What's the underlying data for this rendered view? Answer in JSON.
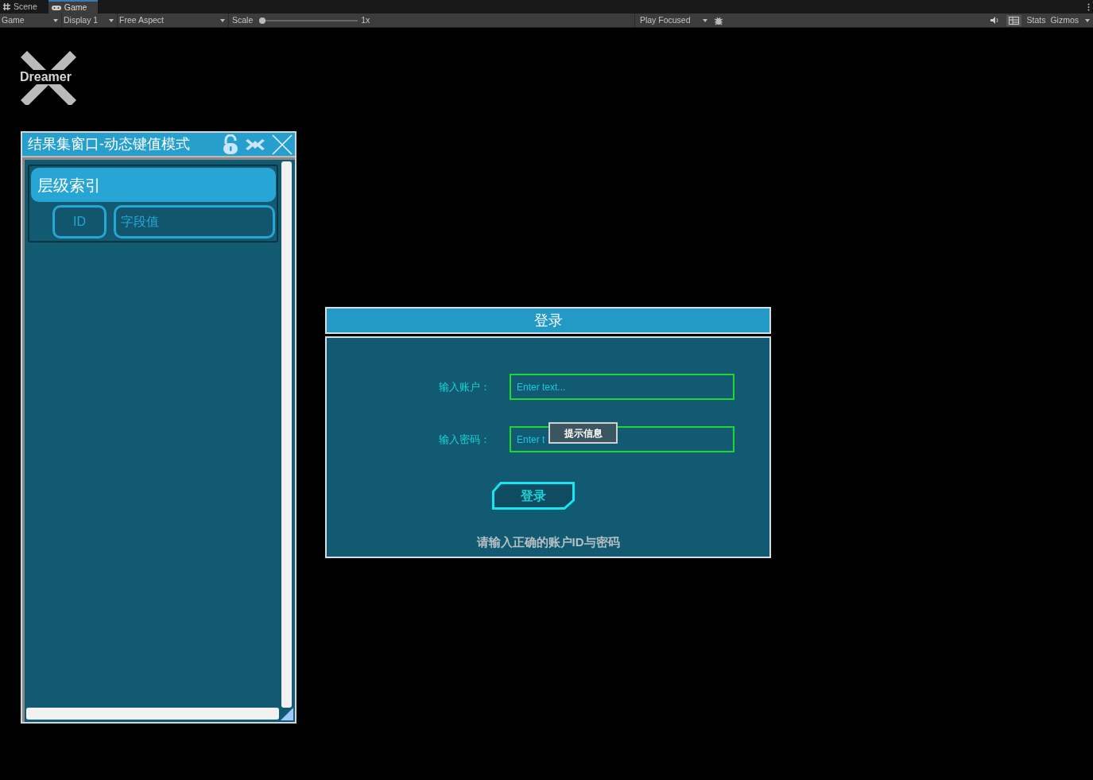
{
  "tabs": [
    {
      "label": "Scene",
      "kind": "scene",
      "selected": false
    },
    {
      "label": "Game",
      "kind": "game",
      "selected": true
    }
  ],
  "toolbar": {
    "dropdowns": [
      {
        "label": "Game"
      },
      {
        "label": "Display 1"
      },
      {
        "label": "Free Aspect"
      }
    ],
    "scale": {
      "label": "Scale",
      "level": 0,
      "reading": "1x"
    },
    "play_mode": "Play Focused",
    "stats": "Stats",
    "gizmos": "Gizmos"
  },
  "logo": {
    "text": "Dreamer"
  },
  "result_window": {
    "title": "结果集窗口-动态键值模式",
    "header": "层级索引",
    "columns": [
      "ID",
      "字段值"
    ]
  },
  "login": {
    "title": "登录",
    "fields": [
      {
        "label": "输入账户：",
        "placeholder": "Enter text..."
      },
      {
        "label": "输入密码：",
        "placeholder": "Enter t"
      }
    ],
    "tooltip": "提示信息",
    "button": "登录",
    "hint": "请输入正确的账户ID与密码"
  }
}
